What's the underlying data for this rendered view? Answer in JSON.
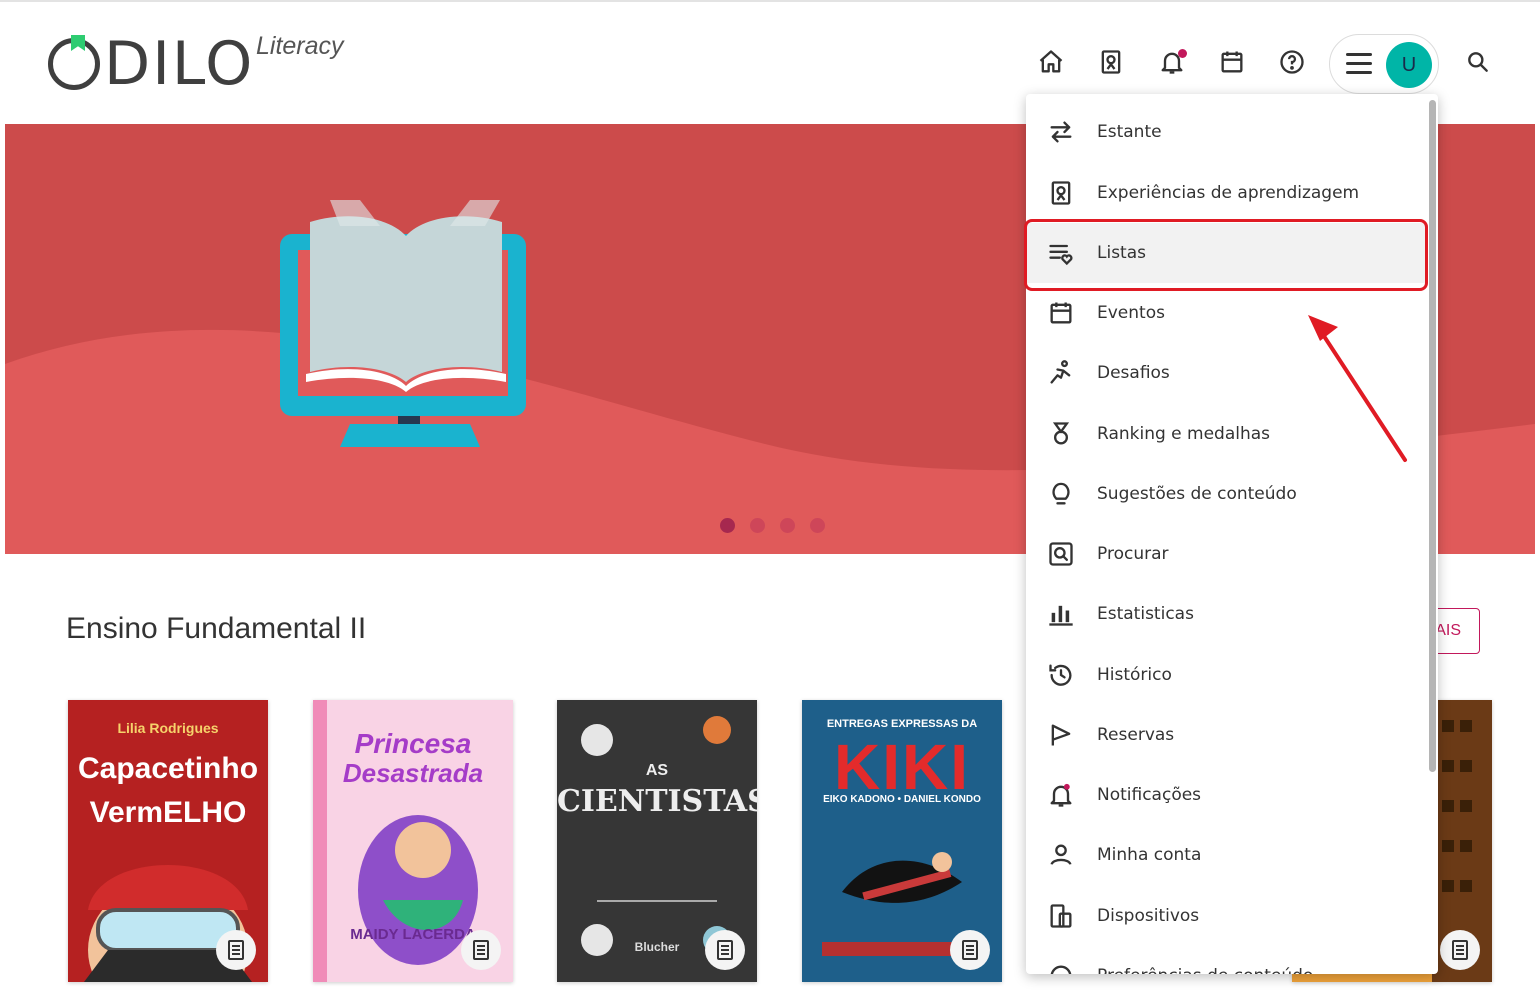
{
  "app": {
    "logo_text": "ODILO",
    "logo_sub": "Literacy"
  },
  "header": {
    "nav_icons": [
      "home-icon",
      "learning-experience-icon",
      "bell-icon",
      "calendar-icon",
      "help-icon"
    ],
    "avatar_initial": "U"
  },
  "banner": {
    "slides_count": 4,
    "active_slide": 1
  },
  "section": {
    "title": "Ensino Fundamental II",
    "more_button": "AIS"
  },
  "books": [
    {
      "author": "Lilia Rodrigues",
      "title_line1": "Capacetinho",
      "title_line2": "VermELHO"
    },
    {
      "author": "",
      "title_line1": "Princesa",
      "title_line2": "Desastrada",
      "publisher": "MAIDY LACERDA"
    },
    {
      "author": "",
      "title_line1": "AS",
      "title_line2": "CIENTISTAS",
      "publisher": "Blucher"
    },
    {
      "author": "EIKO KADONO • DANIEL KONDO",
      "title_line1": "ENTREGAS EXPRESSAS DA",
      "title_line2": "KIKI"
    },
    {
      "author": "",
      "title_line1": "",
      "title_line2": ""
    }
  ],
  "menu": {
    "items": [
      {
        "label": "Estante",
        "icon": "swap-arrows-icon"
      },
      {
        "label": "Experiências de aprendizagem",
        "icon": "learning-experience-icon"
      },
      {
        "label": "Listas",
        "icon": "list-heart-icon"
      },
      {
        "label": "Eventos",
        "icon": "calendar-icon"
      },
      {
        "label": "Desafios",
        "icon": "challenge-icon"
      },
      {
        "label": "Ranking e medalhas",
        "icon": "medal-icon"
      },
      {
        "label": "Sugestões de conteúdo",
        "icon": "lightbulb-icon"
      },
      {
        "label": "Procurar",
        "icon": "search-box-icon"
      },
      {
        "label": "Estatisticas",
        "icon": "bar-chart-icon"
      },
      {
        "label": "Histórico",
        "icon": "history-icon"
      },
      {
        "label": "Reservas",
        "icon": "flag-icon"
      },
      {
        "label": "Notificações",
        "icon": "bell-icon"
      },
      {
        "label": "Minha conta",
        "icon": "user-icon"
      },
      {
        "label": "Dispositivos",
        "icon": "devices-icon"
      },
      {
        "label": "Preferências de conteúdo",
        "icon": "preferences-icon"
      }
    ]
  },
  "colors": {
    "accent": "#c2185b",
    "banner_dark": "#cc4b4b",
    "banner_light": "#e05a5a",
    "avatar": "#00b5a7",
    "highlight": "#e01b24"
  }
}
